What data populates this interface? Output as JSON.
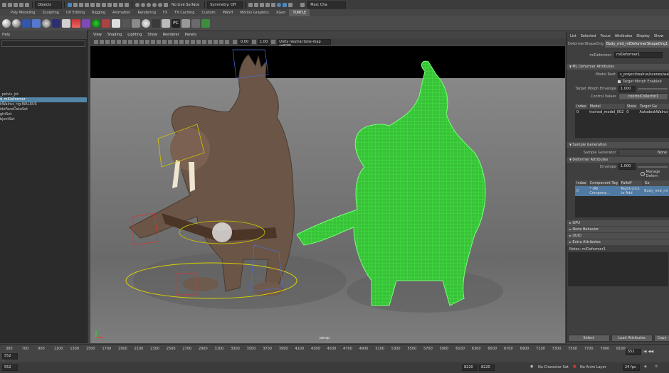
{
  "status_line": {
    "mode_menu": "Objects",
    "live_surface": "No Live Surface",
    "symmetry": "Symmetry: Off",
    "user": "Marc Cha"
  },
  "shelf_tabs": [
    "Poly Modeling",
    "Sculpting",
    "UV Editing",
    "Rigging",
    "Animation",
    "Rendering",
    "FX",
    "FX Caching",
    "Custom",
    "MASH",
    "Motion Graphics",
    "XGen",
    "TURTLE"
  ],
  "shelf_active": "TURTLE",
  "outliner": {
    "help_label": "Help",
    "items": [
      "_pelvis_jnt",
      "d_mlDeformer",
      "kWalrus_rig:WALRUS",
      "ideFaceDataSet",
      "ghtSet",
      "bjectSet"
    ],
    "selected_index": 1
  },
  "viewport": {
    "menu": [
      "View",
      "Shading",
      "Lighting",
      "Show",
      "Renderer",
      "Panels"
    ],
    "exposure": "0.00",
    "gamma": "1.00",
    "colorspace": "Unity neutral tone-map (sRGB)",
    "camera_label": "persp"
  },
  "attribute_editor": {
    "menu": [
      "List",
      "Selected",
      "Focus",
      "Attributes",
      "Display",
      "Show"
    ],
    "tabs": [
      "DeformerShapeOrig",
      "Body_mid_mlDeformerShapeOrig1"
    ],
    "node_label": "mlDeformer:",
    "node_value": "mlDeformer1",
    "ml_section": "ML Deformer Attributes",
    "model_root_label": "Model Root",
    "model_root_value": "s_project/walrus/scenes/wal",
    "target_morph_label": "Target Morph Enabled",
    "envelope_label": "Target Morph Envelope",
    "envelope_value": "1.000",
    "control_values_label": "Control Values",
    "control_values_button": "controlCollector1",
    "table1": {
      "headers": [
        "Index",
        "Model",
        "State",
        "Target Ge"
      ],
      "rows": [
        [
          "0",
          "trained_model_002",
          "0",
          "AutodeskWalrus_rig"
        ]
      ]
    },
    "sample_section": "Sample Generation",
    "sample_label": "Sample Generator",
    "sample_value": "None",
    "deformer_section": "Deformer Attributes",
    "deformer_envelope_label": "Envelope",
    "deformer_envelope_value": "1.000",
    "manage_label": "Manage Deforn",
    "table2": {
      "headers": [
        "Index",
        "Component Tag",
        "Falloff",
        "Ge"
      ],
      "rows": [
        [
          "0",
          "* (All Compone...",
          "Right-click to Add",
          "Body_mid_ml"
        ]
      ]
    },
    "closed_sections": [
      "GPU",
      "Node Behavior",
      "UUID",
      "Extra Attributes"
    ],
    "notes": "Notes: mlDeformer1",
    "bottom_buttons": [
      "Select",
      "Load Attributes",
      "Copy"
    ]
  },
  "time_slider": {
    "ticks": [
      "300",
      "700",
      "900",
      "1100",
      "1300",
      "1500",
      "1700",
      "1900",
      "2100",
      "2300",
      "2500",
      "2700",
      "2900",
      "3100",
      "3300",
      "3500",
      "3700",
      "3900",
      "4100",
      "4300",
      "4500",
      "4700",
      "4900",
      "5100",
      "5300",
      "5500",
      "5700",
      "5900",
      "6100",
      "6300",
      "6500",
      "6700",
      "6900",
      "7100",
      "7300",
      "7500",
      "7700",
      "7900",
      "8100"
    ],
    "current_frame": "552",
    "end_frame": "552"
  },
  "range_bar": {
    "start": "552",
    "range_start": "8220",
    "range_end": "8220",
    "character_set": "No Character Set",
    "anim_layer": "No Anim Layer",
    "fps": "24 fps"
  }
}
